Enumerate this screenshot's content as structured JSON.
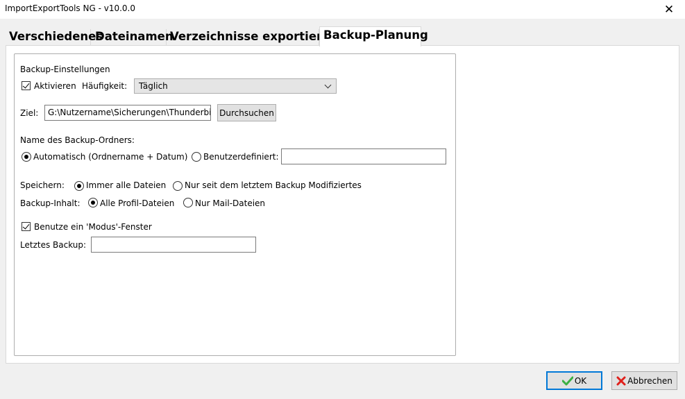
{
  "window": {
    "title": "ImportExportTools NG - v10.0.0",
    "close_glyph": "✕"
  },
  "tabs": [
    {
      "label": "Verschiedenes"
    },
    {
      "label": "Dateinamen"
    },
    {
      "label": "Verzeichnisse exportieren"
    },
    {
      "label": "Backup-Planung",
      "active": true
    }
  ],
  "settings": {
    "group_label": "Backup-Einstellungen",
    "activate_label": "Aktivieren",
    "activate_checked": true,
    "frequency_label": "Häufigkeit:",
    "frequency_value": "Täglich",
    "target_label": "Ziel:",
    "target_value": "G:\\Nutzername\\Sicherungen\\Thunderbird",
    "browse_label": "Durchsuchen",
    "folder_name_label": "Name des Backup-Ordners:",
    "auto_label": "Automatisch (Ordnername + Datum)",
    "custom_label": "Benutzerdefiniert:",
    "custom_value": "",
    "save_label": "Speichern:",
    "save_all_label": "Immer alle Dateien",
    "save_modified_label": "Nur seit dem letztem Backup Modifiziertes",
    "content_label": "Backup-Inhalt:",
    "content_all_label": "Alle Profil-Dateien",
    "content_mail_label": "Nur Mail-Dateien",
    "modal_label": "Benutze ein 'Modus'-Fenster",
    "modal_checked": true,
    "last_backup_label": "Letztes Backup:",
    "last_backup_value": ""
  },
  "footer": {
    "ok_label": "OK",
    "cancel_label": "Abbrechen"
  },
  "colors": {
    "ok_check": "#3cb043",
    "cancel_x": "#e0201b",
    "focus_border": "#0078d7"
  }
}
